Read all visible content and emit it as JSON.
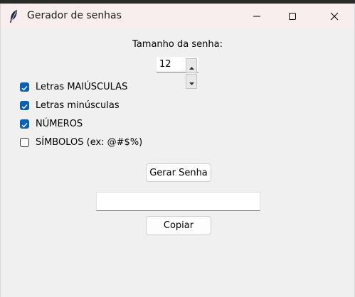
{
  "window": {
    "title": "Gerador de senhas"
  },
  "size": {
    "label": "Tamanho da senha:",
    "value": "12"
  },
  "options": [
    {
      "label": "Letras MAIÚSCULAS",
      "checked": true
    },
    {
      "label": "Letras minúsculas",
      "checked": true
    },
    {
      "label": "NÚMEROS",
      "checked": true
    },
    {
      "label": "SÍMBOLOS (ex: @#$%)",
      "checked": false
    }
  ],
  "actions": {
    "generate_label": "Gerar Senha",
    "copy_label": "Copiar"
  },
  "output": {
    "value": ""
  },
  "colors": {
    "check_accent": "#0a5fb4",
    "titlebar": "#f8eeee",
    "background": "#f0f0f0"
  }
}
